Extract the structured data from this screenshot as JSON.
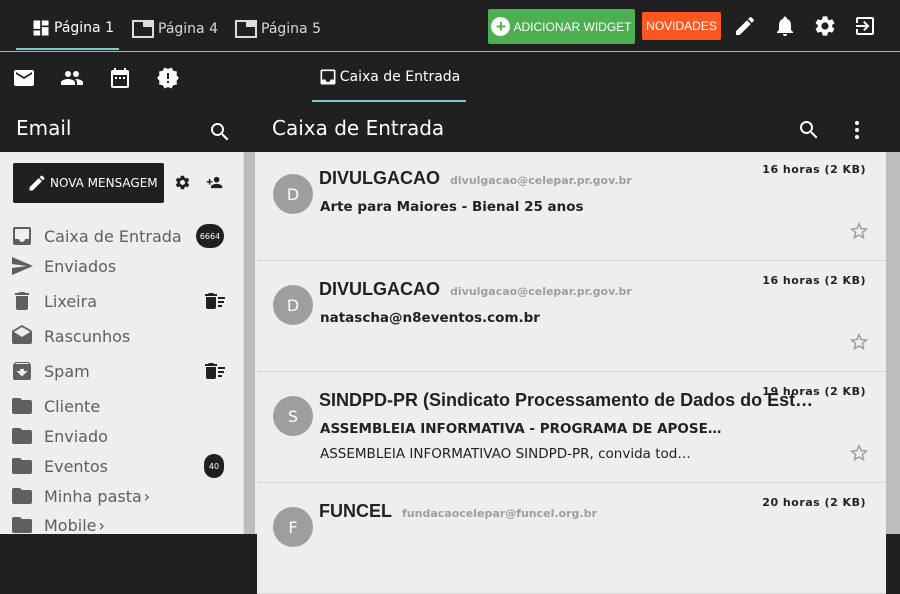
{
  "topbar": {
    "tabs": [
      {
        "label": "Página 1",
        "active": true
      },
      {
        "label": "Página 4",
        "active": false
      },
      {
        "label": "Página 5",
        "active": false
      }
    ],
    "add_widget_label": "ADICIONAR WIDGET",
    "news_label": "NOVIDADES",
    "icons": [
      "pencil-icon",
      "bell-icon",
      "gear-icon",
      "logout-icon"
    ],
    "colors": {
      "accent": "#7fc9c1",
      "widget_green": "#4caf50",
      "news_orange": "#ff5722"
    }
  },
  "subbar": {
    "icons": [
      "mail-icon",
      "people-icon",
      "calendar-icon",
      "alert-badge-icon"
    ],
    "active_tab": "Caixa de Entrada"
  },
  "sidebar": {
    "title": "Email",
    "new_message_label": "NOVA MENSAGEM",
    "folders": [
      {
        "label": "Caixa de Entrada",
        "icon": "inbox-icon",
        "badge": "6664"
      },
      {
        "label": "Enviados",
        "icon": "send-icon"
      },
      {
        "label": "Lixeira",
        "icon": "trash-icon",
        "action": "empty-trash-icon"
      },
      {
        "label": "Rascunhos",
        "icon": "drafts-icon"
      },
      {
        "label": "Spam",
        "icon": "spam-icon",
        "action": "empty-trash-icon"
      },
      {
        "label": "Cliente",
        "icon": "folder-icon"
      },
      {
        "label": "Enviado",
        "icon": "folder-icon"
      },
      {
        "label": "Eventos",
        "icon": "folder-icon",
        "badge": "40"
      },
      {
        "label": "Minha pasta",
        "icon": "folder-icon",
        "expandable": true
      },
      {
        "label": "Mobile",
        "icon": "folder-icon",
        "expandable": true
      }
    ]
  },
  "main": {
    "title": "Caixa de Entrada",
    "messages": [
      {
        "initial": "D",
        "sender": "DIVULGACAO",
        "email": "divulgacao@celepar.pr.gov.br",
        "when": "16 horas (2 KB)",
        "subject": "Arte para Maiores - Bienal 25 anos",
        "preview": ""
      },
      {
        "initial": "D",
        "sender": "DIVULGACAO",
        "email": "divulgacao@celepar.pr.gov.br",
        "when": "16 horas (2 KB)",
        "subject": "natascha@n8eventos.com.br",
        "preview": ""
      },
      {
        "initial": "S",
        "sender": "SINDPD-PR (Sindicato Processamento de Dados do Est…",
        "email": "",
        "when": "19 horas (2 KB)",
        "subject": "ASSEMBLEIA INFORMATIVA - PROGRAMA DE APOSE…",
        "preview": "ASSEMBLEIA INFORMATIVAO SINDPD-PR, convida tod…"
      },
      {
        "initial": "F",
        "sender": "FUNCEL",
        "email": "fundacaocelepar@funcel.org.br",
        "when": "20 horas (2 KB)",
        "subject": "",
        "preview": ""
      }
    ]
  }
}
